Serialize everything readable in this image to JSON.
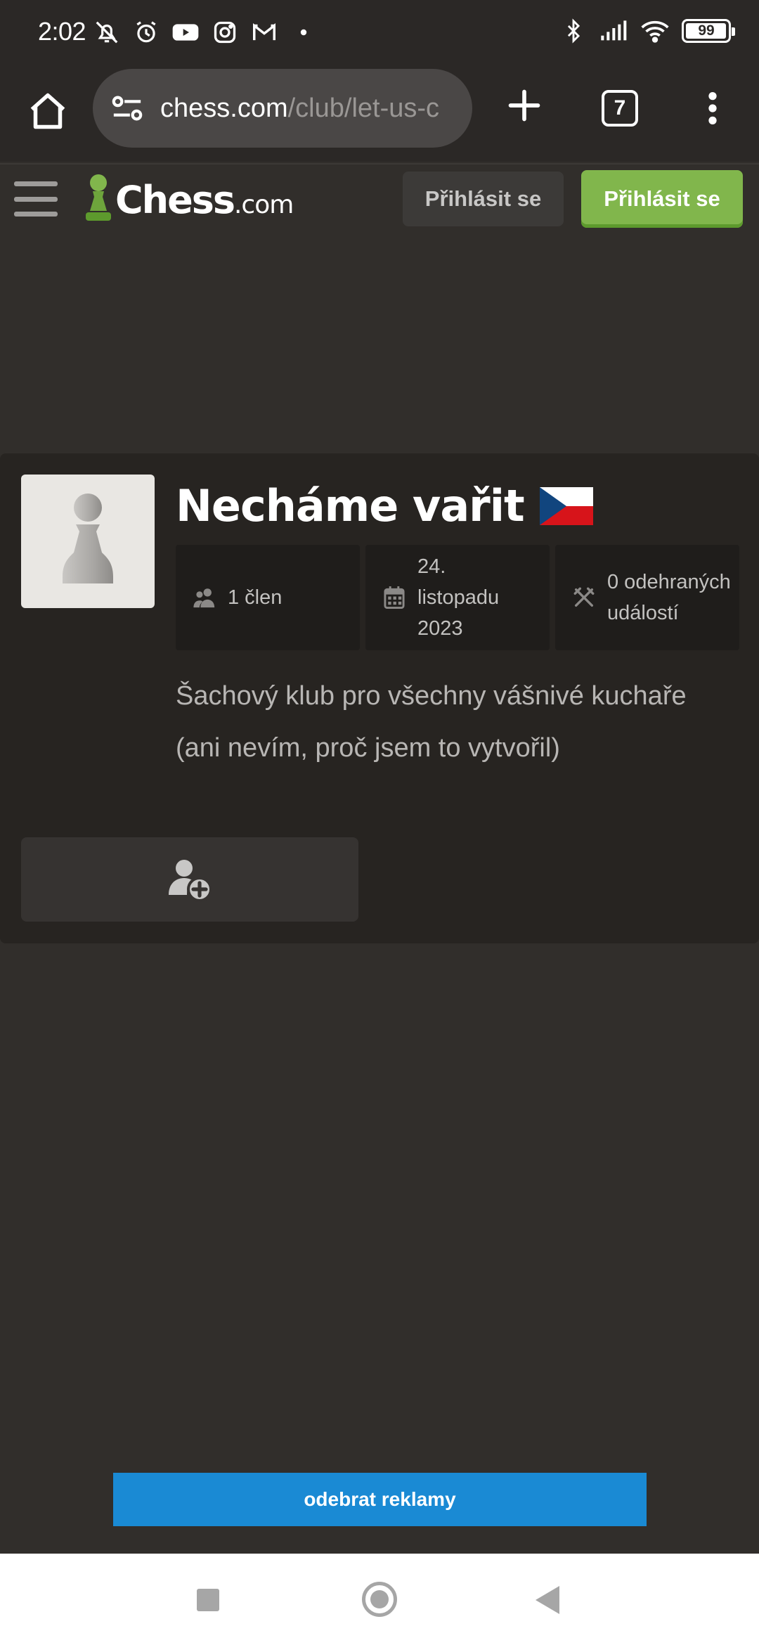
{
  "status_bar": {
    "time": "2:02",
    "battery": "99",
    "battery_level": 0.99,
    "icons_left": [
      "muted-icon",
      "alarm-icon",
      "youtube-icon",
      "instagram-icon",
      "gmail-icon",
      "dot-icon"
    ],
    "icons_right": [
      "bluetooth-icon",
      "signal-icon",
      "wifi-icon",
      "battery-icon"
    ]
  },
  "browser": {
    "url_domain": "chess.com",
    "url_path": "/club/let-us-c",
    "tab_count": "7"
  },
  "header": {
    "logo_text": "Chess",
    "logo_suffix": ".com",
    "login_label": "Přihlásit se",
    "signup_label": "Přihlásit se"
  },
  "club": {
    "name": "Necháme vařit",
    "flag": "czech-flag-icon",
    "stats": [
      {
        "icon": "members-icon",
        "label": "1 člen"
      },
      {
        "icon": "calendar-icon",
        "label": "24. listopadu 2023"
      },
      {
        "icon": "crossed-swords-icon",
        "label": "0 odehraných událostí"
      }
    ],
    "description": "Šachový klub pro všechny vášnivé kuchaře (ani nevím, proč jsem to vytvořil)",
    "join_icon": "add-user-icon"
  },
  "ad": {
    "remove_ads_label": "odebrat reklamy"
  },
  "colors": {
    "background": "#312e2b",
    "card": "#272421",
    "green": "#81b64c",
    "blue": "#1a8ad4"
  }
}
